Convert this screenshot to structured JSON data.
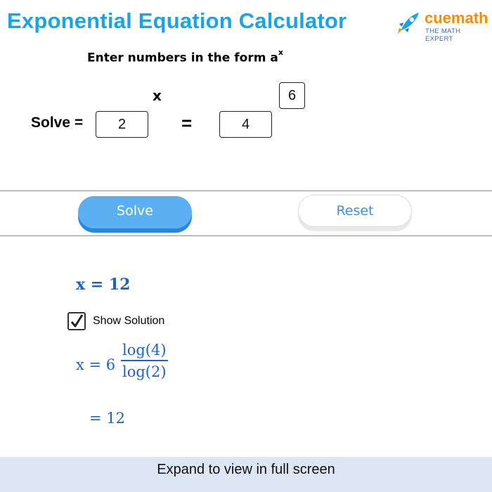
{
  "header": {
    "title": "Exponential Equation Calculator",
    "logo": {
      "name": "cuemath",
      "tagline": "THE MATH EXPERT",
      "icon": "rocket-icon"
    }
  },
  "form": {
    "instruction_text": "Enter numbers in the form a",
    "instruction_sup": "x",
    "x_label": "x",
    "solve_label": "Solve =",
    "base_value": "2",
    "equals_sign": "=",
    "result_value": "4",
    "exponent_value": "6"
  },
  "buttons": {
    "solve": "Solve",
    "reset": "Reset"
  },
  "result": {
    "answer": "x = 12",
    "show_solution_label": "Show Solution",
    "show_solution_checked": true,
    "solution_lhs": "x = 6",
    "numerator": "log(4)",
    "denominator": "log(2)",
    "final": "= 12"
  },
  "footer": {
    "text": "Expand to view in full screen"
  },
  "colors": {
    "title": "#1aa3e8",
    "accent_blue": "#5bb0f4",
    "math_blue": "#1c63c7",
    "divider": "#29b3c9",
    "footer_bg": "#dde6f3",
    "logo_orange": "#ff8a00"
  }
}
